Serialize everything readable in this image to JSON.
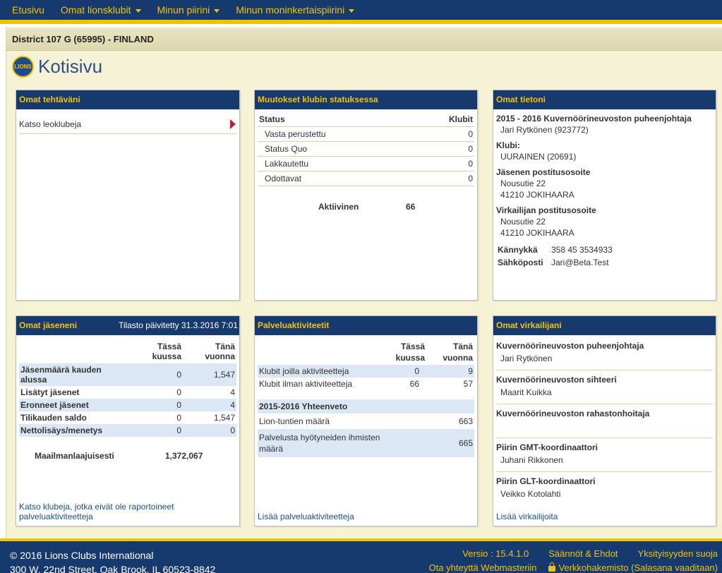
{
  "nav": {
    "items": [
      {
        "label": "Etusivu",
        "caret": false
      },
      {
        "label": "Omat lionsklubit",
        "caret": true
      },
      {
        "label": "Minun piirini",
        "caret": true
      },
      {
        "label": "Minun moninkertaispiirini",
        "caret": true
      }
    ]
  },
  "district": "District 107 G (65995) - FINLAND",
  "page_title": "Kotisivu",
  "logo_text": "LIONS",
  "tasks": {
    "title": "Omat tehtäväni",
    "items": [
      "Katso leoklubeja"
    ]
  },
  "status": {
    "title": "Muutokset klubin statuksessa",
    "col_status": "Status",
    "col_clubs": "Klubit",
    "rows": [
      {
        "label": "Vasta perustettu",
        "value": "0"
      },
      {
        "label": "Status Quo",
        "value": "0"
      },
      {
        "label": "Lakkautettu",
        "value": "0"
      },
      {
        "label": "Odottavat",
        "value": "0"
      }
    ],
    "active_label": "Aktiivinen",
    "active_value": "66"
  },
  "my_info": {
    "title": "Omat tietoni",
    "role": "2015 - 2016 Kuvernöörineuvoston puheenjohtaja",
    "name": "Jari Rytkönen (923772)",
    "club_label": "Klubi:",
    "club": "UURAINEN (20691)",
    "member_addr_label": "Jäsenen postitusosoite",
    "member_addr_1": "Nousutie 22",
    "member_addr_2": "41210 JOKIHAARA",
    "officer_addr_label": "Virkailijan postitusosoite",
    "officer_addr_1": "Nousutie 22",
    "officer_addr_2": "41210 JOKIHAARA",
    "mobile_label": "Kännykkä",
    "mobile": "358 45 3534933",
    "email_label": "Sähköposti",
    "email": "Jari@Beta.Test"
  },
  "members": {
    "title": "Omat jäseneni",
    "updated": "Tilasto päivitetty 31.3.2016 7:01",
    "col_month": "Tässä kuussa",
    "col_year": "Tänä vuonna",
    "rows": [
      {
        "label": "Jäsenmäärä kauden alussa",
        "month": "0",
        "year": "1,547"
      },
      {
        "label": "Lisätyt jäsenet",
        "month": "0",
        "year": "4"
      },
      {
        "label": "Eronneet jäsenet",
        "month": "0",
        "year": "4"
      },
      {
        "label": "Tilikauden saldo",
        "month": "0",
        "year": "1,547"
      },
      {
        "label": "Nettolisäys/menetys",
        "month": "0",
        "year": "0"
      }
    ],
    "world_label": "Maailmanlaajuisesti",
    "world_value": "1,372,067",
    "footer_link": "Katso klubeja, jotka eivät ole raportoineet palveluaktiviteetteja"
  },
  "service": {
    "title": "Palveluaktiviteetit",
    "col_month_1": "Tässä",
    "col_month_2": "kuussa",
    "col_year_1": "Tänä",
    "col_year_2": "vuonna",
    "rows": [
      {
        "label": "Klubit joilla aktiviteetteja",
        "month": "0",
        "year": "9"
      },
      {
        "label": "Klubit ilman aktiviteetteja",
        "month": "66",
        "year": "57"
      }
    ],
    "summary_title": "2015-2016 Yhteenveto",
    "summary_rows": [
      {
        "label": "Lion-tuntien määrä",
        "value": "663"
      },
      {
        "label": "Palvelusta hyötyneiden ihmisten määrä",
        "value": "665"
      }
    ],
    "footer_link": "Lisää palveluaktiviteetteja"
  },
  "officers": {
    "title": "Omat virkailijani",
    "items": [
      {
        "title": "Kuvernöörineuvoston puheenjohtaja",
        "name": "Jari Rytkönen"
      },
      {
        "title": "Kuvernöörineuvoston sihteeri",
        "name": "Maarit Kuikka"
      },
      {
        "title": "Kuvernöörineuvoston rahastonhoitaja",
        "name": ""
      },
      {
        "title": "Piirin GMT-koordinaattori",
        "name": "Juhani Rikkonen"
      },
      {
        "title": "Piirin GLT-koordinaattori",
        "name": "Veikko Kotolahti"
      }
    ],
    "footer_link": "Lisää virkailijoita"
  },
  "footer": {
    "copyright": "© 2016 Lions Clubs International",
    "address": "300 W. 22nd Street, Oak Brook, IL 60523-8842",
    "version": "Versio : 15.4.1.0",
    "terms": "Säännöt & Ehdot",
    "privacy": "Yksityisyyden suoja",
    "contact": "Ota yhteyttä Webmasteriin",
    "directory": "Verkkohakemisto (Salasana vaaditaan)"
  },
  "colors": {
    "navy": "#173a6e",
    "gold": "#f1c400",
    "row_blue": "#dbe7f4"
  }
}
